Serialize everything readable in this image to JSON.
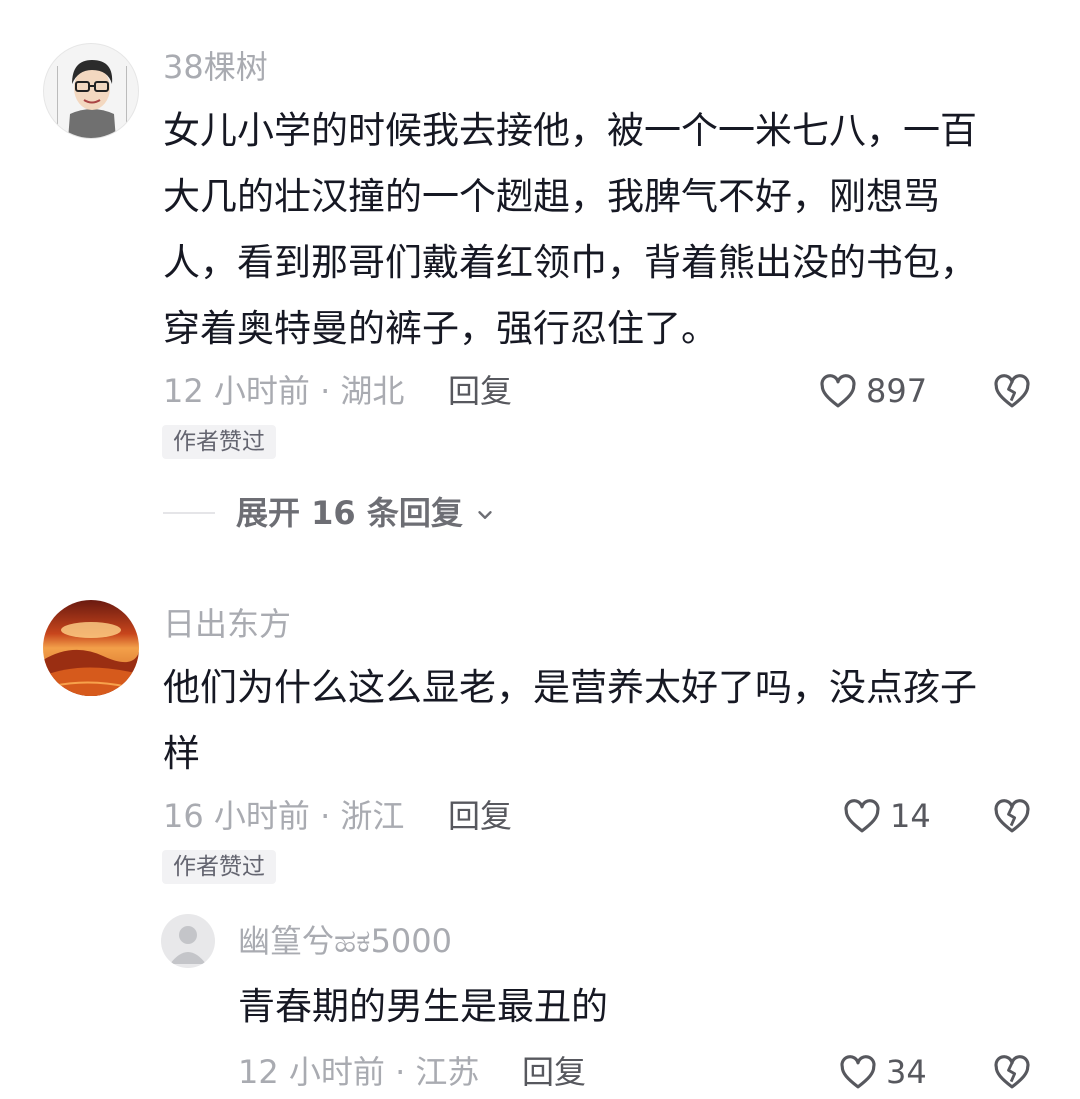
{
  "comments": [
    {
      "username": "38棵树",
      "text_lines": [
        "女儿小学的时候我去接他，被一个一米七八，一百",
        "大几的壮汉撞的一个趔趄，我脾气不好，刚想骂",
        "人，看到那哥们戴着红领巾，背着熊出没的书包，",
        "穿着奥特曼的裤子，强行忍住了。"
      ],
      "meta": "12 小时前 · 湖北",
      "reply_label": "回复",
      "likes": "897",
      "badge": "作者赞过",
      "expand_label": "展开 16 条回复",
      "avatar": "cartoon-boy-glasses"
    },
    {
      "username": "日出东方",
      "text_lines": [
        "他们为什么这么显老，是营养太好了吗，没点孩子",
        "样"
      ],
      "meta": "16 小时前 · 浙江",
      "reply_label": "回复",
      "likes": "14",
      "badge": "作者赞过",
      "avatar": "desert-sunset"
    }
  ],
  "reply": {
    "username": "幽篁兮ಹಕ5000",
    "text": "青春期的男生是最丑的",
    "meta": "12 小时前 · 江苏",
    "reply_label": "回复",
    "likes": "34",
    "avatar": "default-avatar"
  },
  "icons": {
    "like": "heart-outline-icon",
    "dislike": "broken-heart-icon",
    "expand": "chevron-down-icon"
  },
  "colors": {
    "text": "#161823",
    "secondary": "#a9abb1",
    "action": "#57585e",
    "badge_bg": "#f2f2f4"
  }
}
